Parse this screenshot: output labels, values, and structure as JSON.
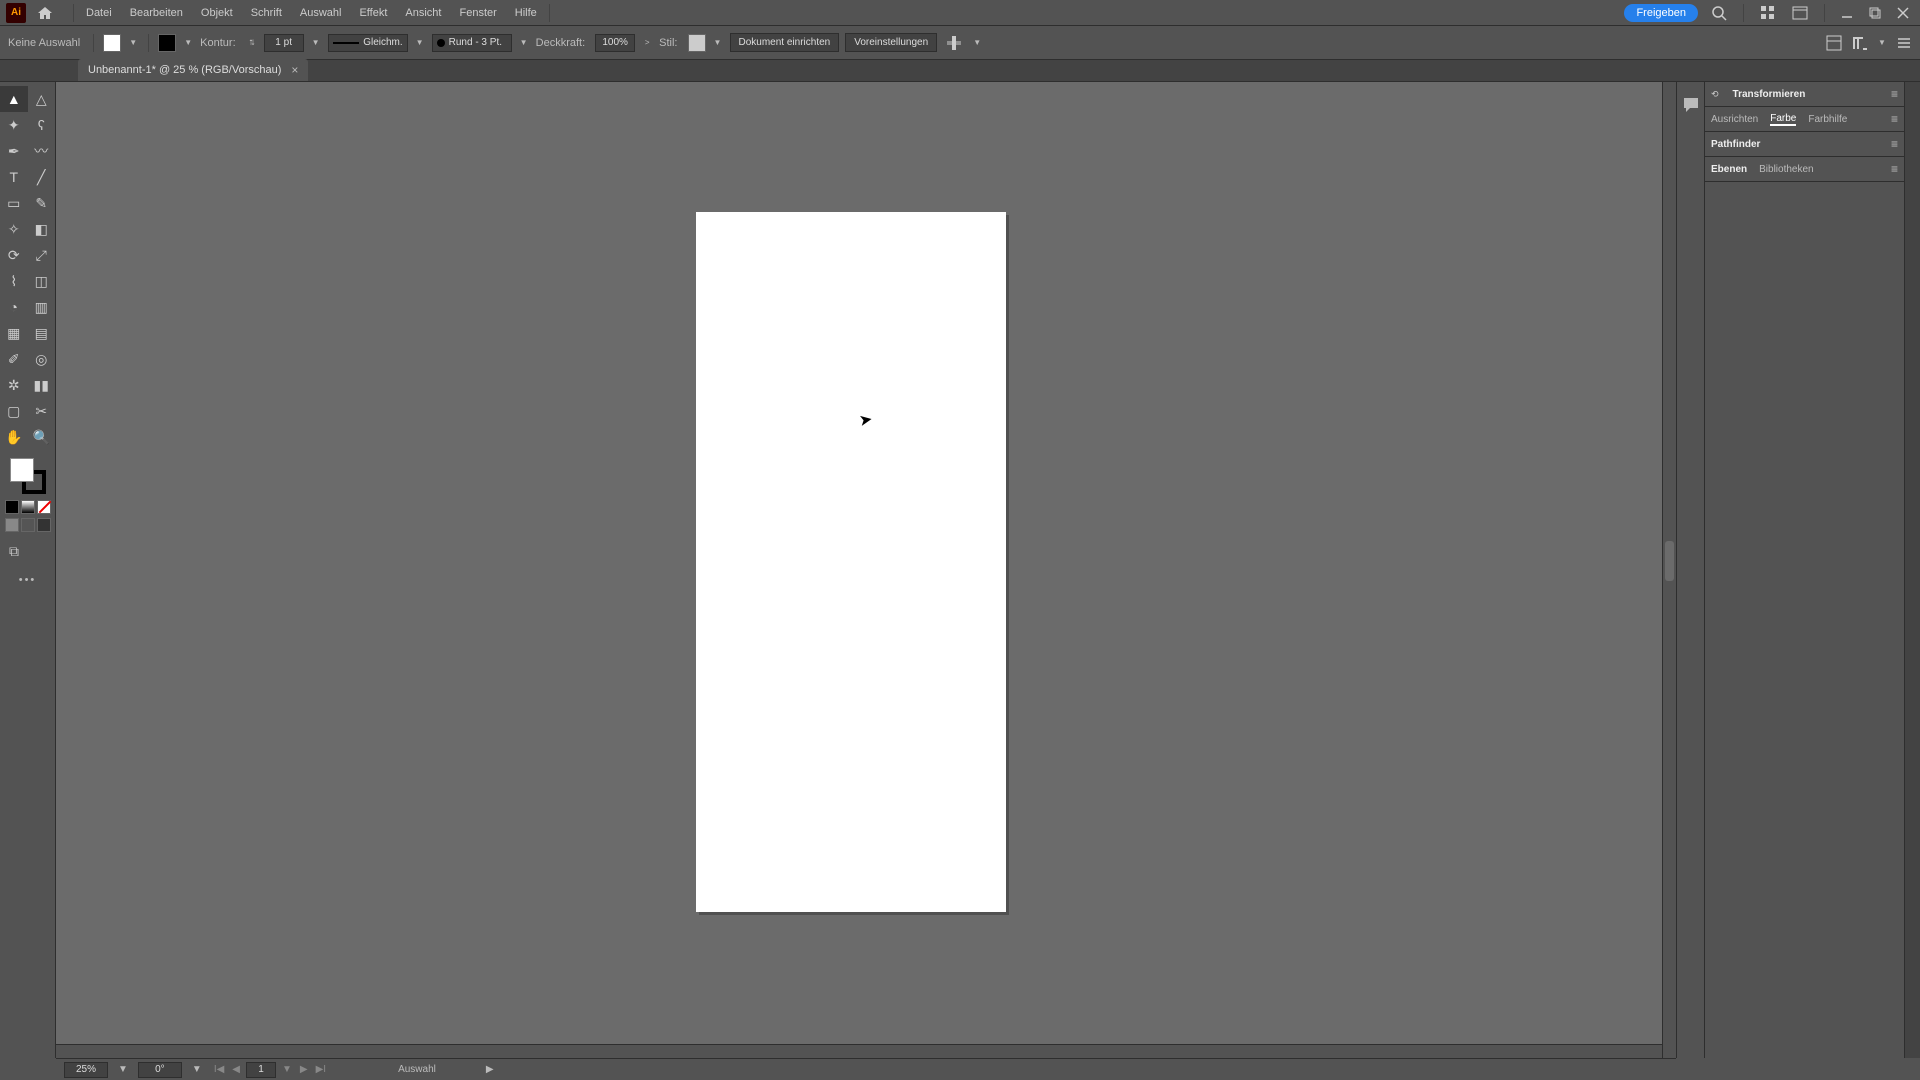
{
  "app": {
    "logo_text": "Ai"
  },
  "menu": {
    "items": [
      "Datei",
      "Bearbeiten",
      "Objekt",
      "Schrift",
      "Auswahl",
      "Effekt",
      "Ansicht",
      "Fenster",
      "Hilfe"
    ]
  },
  "topright": {
    "share": "Freigeben"
  },
  "controlbar": {
    "selection": "Keine Auswahl",
    "stroke_label": "Kontur:",
    "stroke_weight": "1 pt",
    "uniform": "Gleichm.",
    "profile": "Rund - 3 Pt.",
    "opacity_label": "Deckkraft:",
    "opacity_value": "100%",
    "style_label": "Stil:",
    "doc_setup": "Dokument einrichten",
    "prefs": "Voreinstellungen"
  },
  "tabs": {
    "doc": "Unbenannt-1* @ 25 % (RGB/Vorschau)"
  },
  "panels": {
    "g1": {
      "t1": "Transformieren"
    },
    "g2": {
      "t1": "Ausrichten",
      "t2": "Farbe",
      "t3": "Farbhilfe"
    },
    "g3": {
      "t1": "Pathfinder"
    },
    "g4": {
      "t1": "Ebenen",
      "t2": "Bibliotheken"
    }
  },
  "status": {
    "zoom": "25%",
    "rotation": "0°",
    "artboard": "1",
    "tool": "Auswahl"
  }
}
